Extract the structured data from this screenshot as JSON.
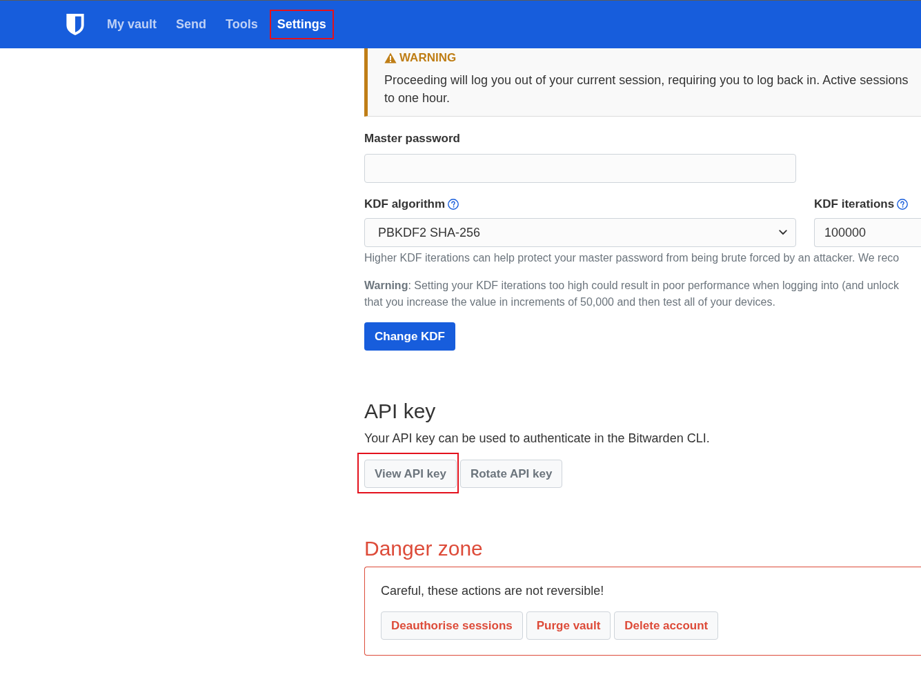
{
  "nav": {
    "items": [
      {
        "label": "My vault",
        "selected": false,
        "highlighted": false
      },
      {
        "label": "Send",
        "selected": false,
        "highlighted": false
      },
      {
        "label": "Tools",
        "selected": false,
        "highlighted": false
      },
      {
        "label": "Settings",
        "selected": true,
        "highlighted": true
      }
    ]
  },
  "warning_callout": {
    "title": "WARNING",
    "lines": [
      "Proceeding will log you out of your current session, requiring you to log back in. Active sessions",
      "to one hour."
    ]
  },
  "master_password": {
    "label": "Master password"
  },
  "kdf_algorithm": {
    "label": "KDF algorithm",
    "value": "PBKDF2 SHA-256"
  },
  "kdf_iterations": {
    "label": "KDF iterations",
    "value": "100000"
  },
  "kdf_help": "Higher KDF iterations can help protect your master password from being brute forced by an attacker. We reco",
  "kdf_warning": {
    "lines": [
      "**Warning**: Setting your KDF iterations too high could result in poor performance when logging into (and unlock",
      "that you increase the value in increments of 50,000 and then test all of your devices."
    ]
  },
  "change_kdf_button": "Change KDF",
  "api_key": {
    "heading": "API key",
    "description": "Your API key can be used to authenticate in the Bitwarden CLI.",
    "buttons": [
      {
        "label": "View API key",
        "highlighted": true
      },
      {
        "label": "Rotate API key",
        "highlighted": false
      }
    ]
  },
  "danger_zone": {
    "heading": "Danger zone",
    "description": "Careful, these actions are not reversible!",
    "buttons": [
      {
        "label": "Deauthorise sessions"
      },
      {
        "label": "Purge vault"
      },
      {
        "label": "Delete account"
      }
    ]
  }
}
